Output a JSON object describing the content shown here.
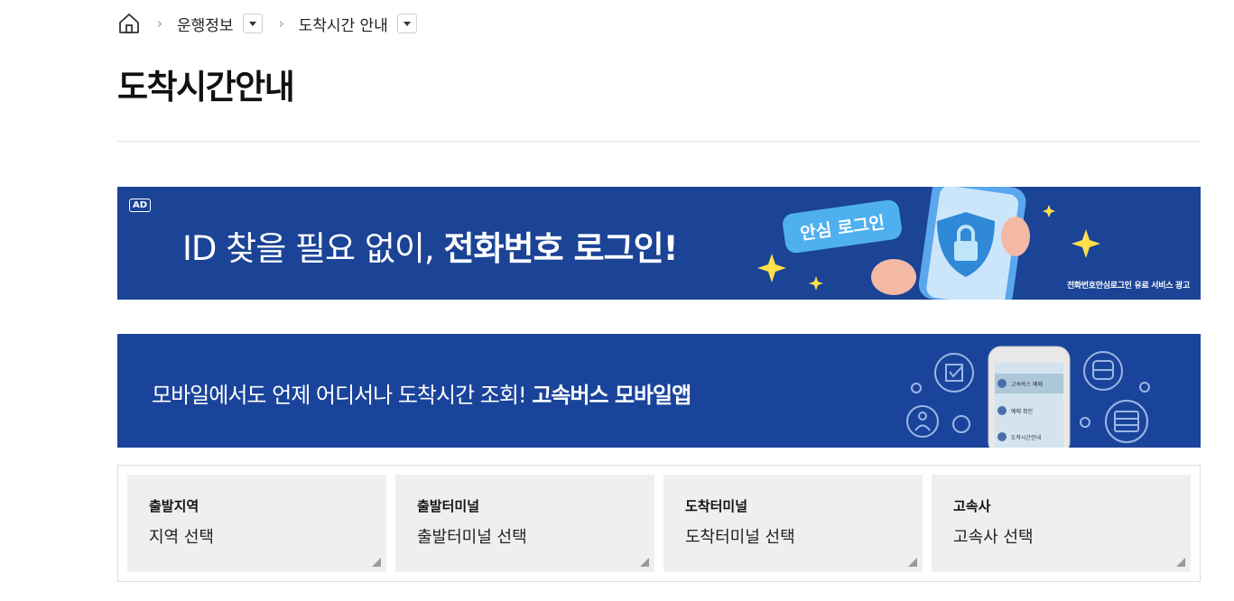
{
  "breadcrumb": {
    "home_icon": "home-icon",
    "items": [
      {
        "label": "운행정보",
        "icon": "caret-down-icon"
      },
      {
        "label": "도착시간 안내",
        "icon": "caret-down-icon"
      }
    ]
  },
  "page": {
    "title": "도착시간안내"
  },
  "ad_banner": {
    "badge": "AD",
    "headline_normal": "ID 찾을 필요 없이, ",
    "headline_bold": "전화번호 로그인!",
    "bubble_text": "안심 로그인",
    "disclaimer": "전화번호안심로그인 유료 서비스 광고",
    "icons": [
      "phone-icon",
      "lock-shield-icon",
      "sparkle-icon"
    ]
  },
  "app_banner": {
    "text_normal": "모바일에서도 언제 어디서나 도착시간 조회! ",
    "text_bold": "고속버스 모바일앱",
    "phone_menu": [
      "고속버스 예매",
      "예매 확인",
      "도착시간안내"
    ],
    "icons": [
      "checkbox-icon",
      "bus-icon",
      "person-icon",
      "table-icon"
    ]
  },
  "search": {
    "fields": [
      {
        "label": "출발지역",
        "value": "지역 선택"
      },
      {
        "label": "출발터미널",
        "value": "출발터미널 선택"
      },
      {
        "label": "도착터미널",
        "value": "도착터미널 선택"
      },
      {
        "label": "고속사",
        "value": "고속사 선택"
      }
    ]
  },
  "colors": {
    "banner_blue": "#1b4396",
    "app_banner_blue": "#1a449b",
    "select_bg": "#efefef"
  }
}
